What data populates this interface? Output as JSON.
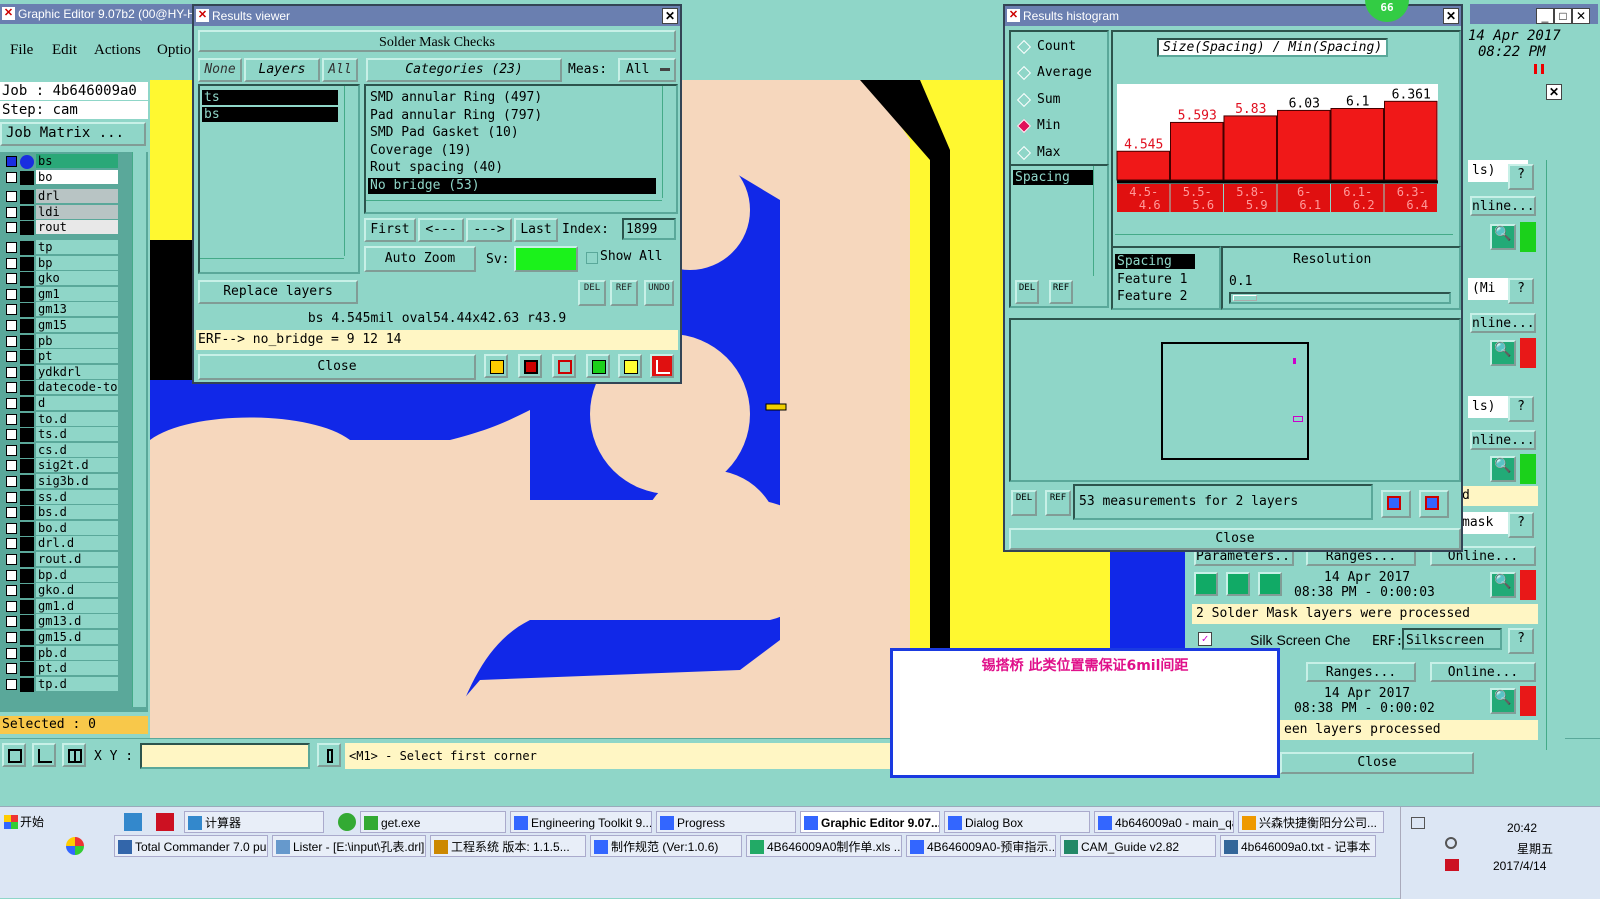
{
  "main": {
    "title": "Graphic Editor 9.07b2 (00@HY-H",
    "menu": [
      "File",
      "Edit",
      "Actions",
      "Optio"
    ],
    "job": "Job : 4b646009a0",
    "step": "Step: cam",
    "job_matrix": "Job Matrix ...",
    "selected": "Selected : 0",
    "xy_label": "X Y :",
    "status_prompt": "<M1> - Select first corner",
    "date": "14 Apr 2017",
    "time": "08:22 PM"
  },
  "layers": [
    "bs",
    "bo",
    "drl",
    "ldi",
    "rout",
    "tp",
    "bp",
    "gko",
    "gm1",
    "gm13",
    "gm15",
    "pb",
    "pt",
    "ydkdrl",
    "datecode-to",
    "d",
    "to.d",
    "ts.d",
    "cs.d",
    "sig2t.d",
    "sig3b.d",
    "ss.d",
    "bs.d",
    "bo.d",
    "drl.d",
    "rout.d",
    "bp.d",
    "gko.d",
    "gm1.d",
    "gm13.d",
    "gm15.d",
    "pb.d",
    "pt.d",
    "tp.d"
  ],
  "results": {
    "title": "Results viewer",
    "header": "Solder Mask Checks",
    "none": "None",
    "layers": "Layers",
    "all": "All",
    "categories": "Categories (23)",
    "meas_label": "Meas:",
    "meas_value": "All",
    "layer_items": [
      "ts",
      "bs"
    ],
    "cat_items": [
      "SMD annular Ring (497)",
      "Pad annular Ring (797)",
      "SMD Pad Gasket (10)",
      "Coverage (19)",
      "Rout spacing (40)",
      "No bridge (53)"
    ],
    "first": "First",
    "prev": "<---",
    "next": "--->",
    "last": "Last",
    "index_label": "Index:",
    "index_value": "1899",
    "auto_zoom": "Auto Zoom",
    "sv": "Sv:",
    "show_all": "Show All",
    "replace_layers": "Replace layers",
    "info": "bs 4.545mil  oval54.44x42.63  r43.9",
    "erf": "ERF--> no_bridge = 9 12 14",
    "close": "Close",
    "del": "DEL",
    "ref": "REF",
    "undo": "UNDO"
  },
  "hist": {
    "title": "Results histogram",
    "badge": "66",
    "options": [
      "Count",
      "Average",
      "Sum",
      "Min",
      "Max"
    ],
    "selected_option": "Min",
    "chart_title": "Size(Spacing) / Min(Spacing)",
    "list_item": "Spacing",
    "feat": [
      "Spacing",
      "Feature 1",
      "Feature 2"
    ],
    "resolution": "Resolution",
    "res_value": "0.1",
    "measurements": "53 measurements for 2 layers",
    "close": "Close"
  },
  "chart_data": {
    "type": "bar",
    "title": "Size(Spacing) / Min(Spacing)",
    "categories": [
      "4.5-4.6",
      "5.5-5.6",
      "5.8-5.9",
      "6-6.1",
      "6.1-6.2",
      "6.3-6.4"
    ],
    "values": [
      4.545,
      5.593,
      5.83,
      6.03,
      6.1,
      6.361
    ],
    "ylim": [
      0,
      6.7
    ]
  },
  "right": {
    "date1": "14 Apr 2017",
    "time1": "08:38 PM - 0:00:03",
    "proc1": "2 Solder Mask layers were processed",
    "silk": "Silk Screen Che",
    "erf": "ERF:",
    "silk_val": "Silkscreen",
    "ranges": "Ranges...",
    "online": "Online...",
    "params": "Parameters...",
    "date2": "14 Apr 2017",
    "time2": "08:38 PM - 0:00:02",
    "proc2": "een layers processed",
    "close": "Close",
    "ls1": "ls)",
    "mi": "(Mi",
    "ls2": "ls)",
    "d": "d",
    "mask": "mask",
    "q": "?",
    "inline": "nline..."
  },
  "note": {
    "text": "锡搭桥   此类位置需保证6mil间距"
  },
  "taskbar": {
    "start": "开始",
    "row1": [
      "计算器",
      "get.exe",
      "Engineering Toolkit 9....",
      "Progress",
      "Graphic Editor 9.07...",
      "Dialog Box",
      "4b646009a0 - main_qa",
      "兴森快捷衡阳分公司..."
    ],
    "row2": [
      "Total Commander 7.0 pu...",
      "Lister - [E:\\input\\孔表.drl]",
      "工程系统  版本: 1.1.5...",
      "制作规范 (Ver:1.0.6)",
      "4B646009A0制作单.xls ...",
      "4B646009A0-预审指示....",
      "CAM_Guide v2.82",
      "4b646009a0.txt - 记事本"
    ],
    "clock": "20:42",
    "weekday": "星期五",
    "sysdate": "2017/4/14"
  }
}
